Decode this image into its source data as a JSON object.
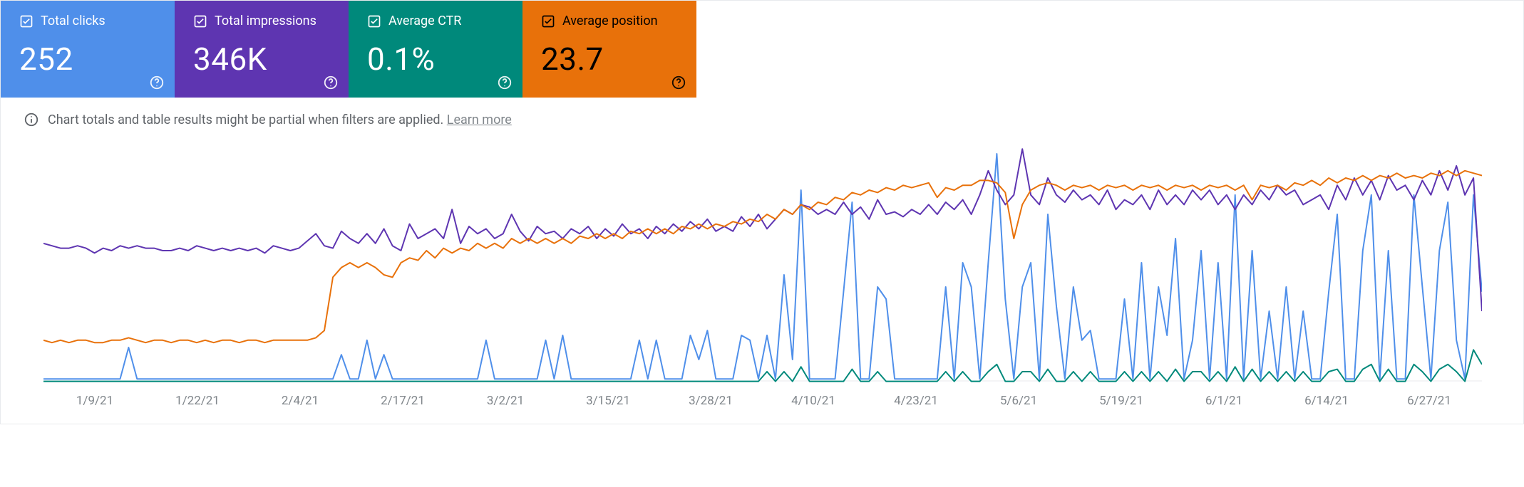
{
  "cards": {
    "clicks": {
      "label": "Total clicks",
      "value": "252"
    },
    "impressions": {
      "label": "Total impressions",
      "value": "346K"
    },
    "ctr": {
      "label": "Average CTR",
      "value": "0.1%"
    },
    "position": {
      "label": "Average position",
      "value": "23.7"
    }
  },
  "notice": {
    "text": "Chart totals and table results might be partial when filters are applied. ",
    "link": "Learn more"
  },
  "x_labels": [
    "1/9/21",
    "1/22/21",
    "2/4/21",
    "2/17/21",
    "3/2/21",
    "3/15/21",
    "3/28/21",
    "4/10/21",
    "4/23/21",
    "5/6/21",
    "5/19/21",
    "6/1/21",
    "6/14/21",
    "6/27/21"
  ],
  "colors": {
    "clicks": "#4f8fea",
    "impressions": "#5e35b1",
    "ctr": "#00897b",
    "position": "#e8710a"
  },
  "chart_data": {
    "type": "line",
    "title": "",
    "xlabel": "",
    "ylabel": "",
    "ylim": [
      0,
      100
    ],
    "x_tick_labels": [
      "1/9/21",
      "1/22/21",
      "2/4/21",
      "2/17/21",
      "3/2/21",
      "3/15/21",
      "3/28/21",
      "4/10/21",
      "4/23/21",
      "5/6/21",
      "5/19/21",
      "6/1/21",
      "6/14/21",
      "6/27/21"
    ],
    "note": "Each series has 170 daily points (≈ 1/9/21–7/3/21). Values are on a 0–100 relative scale (top of plot = 100, bottom = 0) since no y-axis ticks are shown.",
    "series": [
      {
        "name": "Total clicks",
        "color": "#4f8fea",
        "values": [
          2,
          2,
          2,
          2,
          2,
          2,
          2,
          2,
          2,
          2,
          15,
          2,
          2,
          2,
          2,
          2,
          2,
          2,
          2,
          2,
          2,
          2,
          2,
          2,
          2,
          2,
          2,
          2,
          2,
          2,
          2,
          2,
          2,
          2,
          2,
          12,
          2,
          2,
          18,
          2,
          12,
          2,
          2,
          2,
          2,
          2,
          2,
          2,
          2,
          2,
          2,
          2,
          18,
          2,
          2,
          2,
          2,
          2,
          2,
          18,
          2,
          20,
          2,
          2,
          2,
          2,
          2,
          2,
          2,
          2,
          18,
          2,
          18,
          2,
          2,
          2,
          20,
          10,
          22,
          2,
          2,
          2,
          20,
          18,
          2,
          20,
          2,
          45,
          10,
          80,
          2,
          2,
          2,
          2,
          38,
          75,
          2,
          2,
          40,
          35,
          2,
          2,
          2,
          2,
          2,
          2,
          40,
          2,
          50,
          40,
          2,
          50,
          95,
          35,
          2,
          40,
          50,
          2,
          70,
          32,
          2,
          40,
          18,
          22,
          2,
          2,
          2,
          35,
          2,
          50,
          2,
          40,
          20,
          60,
          2,
          18,
          55,
          2,
          50,
          2,
          78,
          2,
          55,
          2,
          30,
          2,
          40,
          2,
          30,
          2,
          2,
          38,
          70,
          2,
          2,
          55,
          78,
          2,
          55,
          2,
          2,
          78,
          40,
          2,
          55,
          75,
          18,
          2,
          78,
          38
        ]
      },
      {
        "name": "Total impressions",
        "color": "#5e35b1",
        "values": [
          58,
          57,
          56,
          56,
          57,
          56,
          54,
          56,
          55,
          57,
          56,
          57,
          56,
          56,
          55,
          55,
          56,
          55,
          57,
          56,
          55,
          56,
          55,
          56,
          55,
          56,
          54,
          57,
          56,
          55,
          56,
          59,
          62,
          57,
          56,
          63,
          60,
          58,
          62,
          58,
          64,
          57,
          55,
          66,
          60,
          62,
          64,
          60,
          72,
          58,
          65,
          62,
          64,
          60,
          62,
          70,
          63,
          59,
          65,
          62,
          63,
          60,
          64,
          62,
          65,
          60,
          64,
          61,
          66,
          62,
          64,
          60,
          65,
          62,
          66,
          63,
          67,
          64,
          68,
          63,
          65,
          63,
          69,
          65,
          70,
          64,
          68,
          72,
          70,
          74,
          73,
          70,
          72,
          70,
          75,
          70,
          73,
          68,
          76,
          70,
          71,
          69,
          72,
          70,
          74,
          70,
          75,
          72,
          76,
          70,
          78,
          88,
          80,
          74,
          78,
          97,
          78,
          74,
          85,
          78,
          75,
          80,
          76,
          78,
          74,
          80,
          72,
          76,
          74,
          78,
          72,
          80,
          74,
          78,
          74,
          80,
          76,
          80,
          74,
          78,
          72,
          78,
          74,
          80,
          76,
          82,
          78,
          80,
          74,
          76,
          78,
          72,
          82,
          76,
          85,
          78,
          84,
          76,
          86,
          80,
          82,
          76,
          84,
          78,
          88,
          80,
          90,
          78,
          85,
          30
        ]
      },
      {
        "name": "Average CTR",
        "color": "#00897b",
        "values": [
          1,
          1,
          1,
          1,
          1,
          1,
          1,
          1,
          1,
          1,
          1,
          1,
          1,
          1,
          1,
          1,
          1,
          1,
          1,
          1,
          1,
          1,
          1,
          1,
          1,
          1,
          1,
          1,
          1,
          1,
          1,
          1,
          1,
          1,
          1,
          1,
          1,
          1,
          1,
          1,
          1,
          1,
          1,
          1,
          1,
          1,
          1,
          1,
          1,
          1,
          1,
          1,
          1,
          1,
          1,
          1,
          1,
          1,
          1,
          1,
          1,
          1,
          1,
          1,
          1,
          1,
          1,
          1,
          1,
          1,
          1,
          1,
          1,
          1,
          1,
          1,
          1,
          1,
          1,
          1,
          1,
          1,
          1,
          1,
          1,
          5,
          1,
          5,
          1,
          7,
          1,
          1,
          1,
          1,
          1,
          6,
          1,
          1,
          5,
          1,
          1,
          1,
          1,
          1,
          1,
          1,
          5,
          1,
          5,
          1,
          1,
          5,
          8,
          1,
          1,
          5,
          5,
          1,
          6,
          1,
          1,
          5,
          1,
          5,
          1,
          1,
          1,
          5,
          1,
          5,
          1,
          5,
          1,
          6,
          1,
          5,
          5,
          1,
          5,
          1,
          7,
          1,
          6,
          1,
          5,
          1,
          5,
          1,
          5,
          1,
          1,
          5,
          6,
          1,
          1,
          6,
          8,
          1,
          6,
          1,
          1,
          8,
          5,
          1,
          6,
          8,
          5,
          1,
          14,
          8
        ]
      },
      {
        "name": "Average position",
        "color": "#e8710a",
        "values": [
          18,
          17,
          18,
          17,
          18,
          18,
          17,
          17,
          18,
          18,
          19,
          18,
          17,
          18,
          18,
          17,
          18,
          18,
          17,
          18,
          17,
          18,
          18,
          17,
          18,
          18,
          17,
          18,
          18,
          18,
          18,
          18,
          19,
          22,
          44,
          48,
          50,
          48,
          50,
          48,
          45,
          44,
          50,
          52,
          51,
          55,
          52,
          56,
          54,
          56,
          55,
          58,
          56,
          58,
          56,
          60,
          58,
          60,
          58,
          60,
          58,
          60,
          58,
          61,
          60,
          62,
          60,
          62,
          60,
          63,
          62,
          64,
          62,
          64,
          62,
          65,
          64,
          66,
          64,
          66,
          65,
          67,
          66,
          68,
          67,
          70,
          68,
          72,
          70,
          74,
          72,
          75,
          74,
          77,
          76,
          79,
          78,
          80,
          79,
          81,
          80,
          82,
          81,
          82,
          83,
          77,
          81,
          80,
          82,
          82,
          84,
          84,
          83,
          79,
          60,
          74,
          80,
          82,
          83,
          82,
          80,
          82,
          81,
          82,
          80,
          82,
          81,
          82,
          80,
          82,
          81,
          82,
          80,
          82,
          81,
          82,
          80,
          82,
          81,
          82,
          80,
          82,
          76,
          82,
          81,
          82,
          80,
          83,
          82,
          84,
          82,
          85,
          83,
          85,
          84,
          86,
          84,
          86,
          85,
          87,
          85,
          86,
          85,
          87,
          86,
          88,
          86,
          88,
          87,
          86
        ]
      }
    ]
  }
}
